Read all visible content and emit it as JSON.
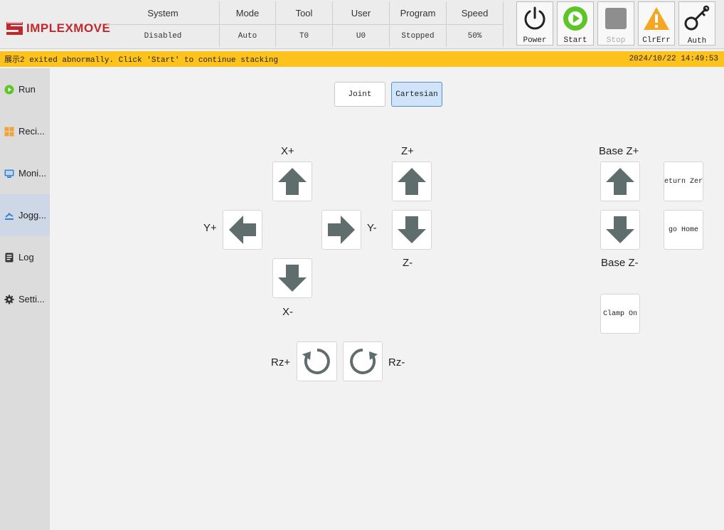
{
  "brand": {
    "name": "IMPLEXMOVE"
  },
  "status": {
    "columns": [
      {
        "header": "System",
        "value": "Disabled"
      },
      {
        "header": "Mode",
        "value": "Auto"
      },
      {
        "header": "Tool",
        "value": "T0"
      },
      {
        "header": "User",
        "value": "U0"
      },
      {
        "header": "Program",
        "value": "Stopped"
      },
      {
        "header": "Speed",
        "value": "50%"
      }
    ]
  },
  "controls": {
    "power": "Power",
    "start": "Start",
    "stop": "Stop",
    "clrerr": "ClrErr",
    "auth": "Auth"
  },
  "alarm": {
    "message": "展示2 exited abnormally. Click 'Start' to continue stacking",
    "timestamp": "2024/10/22 14:49:53"
  },
  "sidebar": {
    "items": [
      {
        "label": "Run",
        "icon": "play-circle-icon"
      },
      {
        "label": "Reci...",
        "icon": "grid-icon"
      },
      {
        "label": "Moni...",
        "icon": "monitor-icon"
      },
      {
        "label": "Jogg...",
        "icon": "jog-icon",
        "active": true
      },
      {
        "label": "Log",
        "icon": "log-icon"
      },
      {
        "label": "Setti...",
        "icon": "gear-icon"
      }
    ]
  },
  "jog": {
    "mode_joint": "Joint",
    "mode_cartesian": "Cartesian",
    "active_mode": "Cartesian",
    "x_plus": "X+",
    "x_minus": "X-",
    "y_plus": "Y+",
    "y_minus": "Y-",
    "z_plus": "Z+",
    "z_minus": "Z-",
    "rz_plus": "Rz+",
    "rz_minus": "Rz-",
    "base_z_plus": "Base Z+",
    "base_z_minus": "Base Z-",
    "return_zero": "eturn Zer",
    "go_home": "go Home",
    "clamp_on": "Clamp On"
  },
  "colors": {
    "brand_red": "#c0282d",
    "alarm_yellow": "#fdc21b",
    "start_green": "#5cc626",
    "warn_orange": "#f5a623",
    "arrow_gray": "#5f6d6c"
  }
}
